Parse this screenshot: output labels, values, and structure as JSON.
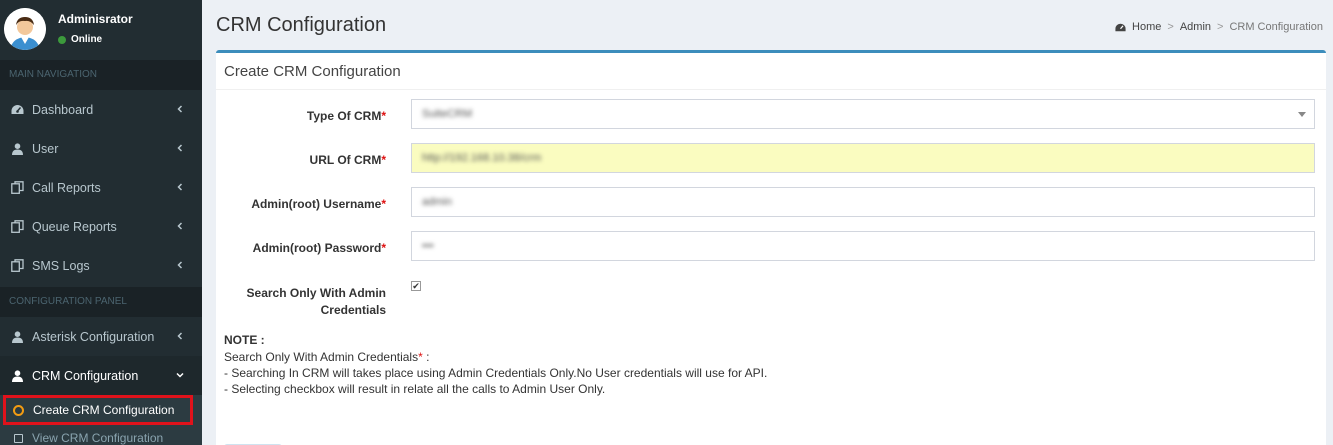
{
  "user": {
    "name": "Adminisrator",
    "status": "Online"
  },
  "sidebar": {
    "main_header": "MAIN NAVIGATION",
    "config_header": "CONFIGURATION PANEL",
    "items": [
      {
        "label": "Dashboard",
        "icon": "dashboard-icon"
      },
      {
        "label": "User",
        "icon": "user-icon"
      },
      {
        "label": "Call Reports",
        "icon": "copy-icon"
      },
      {
        "label": "Queue Reports",
        "icon": "copy-icon"
      },
      {
        "label": "SMS Logs",
        "icon": "copy-icon"
      }
    ],
    "config_items": [
      {
        "label": "Asterisk Configuration",
        "icon": "user-icon"
      },
      {
        "label": "CRM Configuration",
        "icon": "user-icon"
      }
    ],
    "sub_items": [
      {
        "label": "Create CRM Configuration"
      },
      {
        "label": "View CRM Configuration"
      }
    ]
  },
  "header": {
    "title": "CRM Configuration",
    "breadcrumb": [
      "Home",
      "Admin",
      "CRM Configuration"
    ]
  },
  "form": {
    "title": "Create CRM Configuration",
    "fields": {
      "type": {
        "label": "Type Of CRM",
        "value": "SuiteCRM"
      },
      "url": {
        "label": "URL Of CRM",
        "value": "http://192.168.10.38/crm"
      },
      "username": {
        "label": "Admin(root) Username",
        "value": "admin"
      },
      "password": {
        "label": "Admin(root) Password",
        "value": "•••"
      },
      "search_only": {
        "label_line1": "Search Only With Admin",
        "label_line2": "Credentials",
        "checked": true
      }
    },
    "note": {
      "title": "NOTE :",
      "line1": "Search Only With Admin Credentials",
      "line1_suffix": " :",
      "line2": "- Searching In CRM will takes place using Admin Credentials Only.No User credentials will use for API.",
      "line3": "- Selecting checkbox will result in relate all the calls to Admin User Only."
    }
  },
  "colors": {
    "accent": "#3c8dbc",
    "sidebar": "#222d32",
    "highlight": "#e0121b",
    "active_circle": "#f39c12",
    "online": "#3c9a3c"
  }
}
